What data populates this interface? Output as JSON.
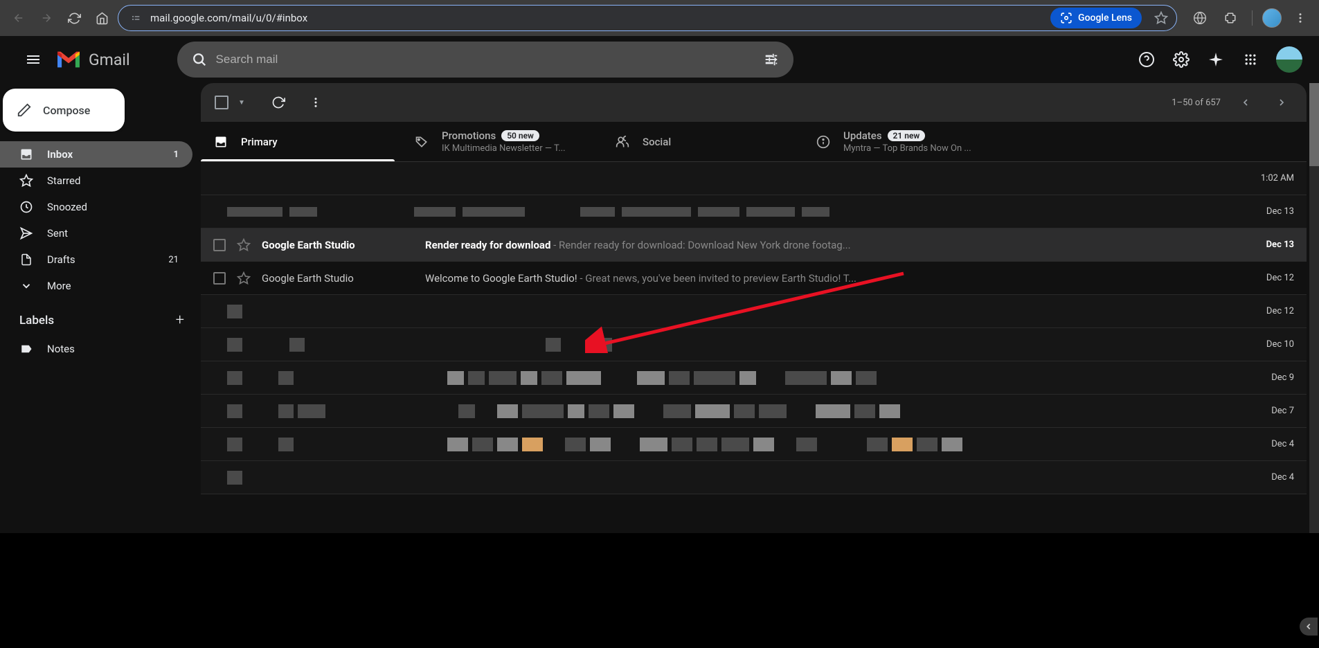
{
  "browser": {
    "url_display": "mail.google.com/mail/u/0/#inbox",
    "lens_label": "Google Lens"
  },
  "header": {
    "app_name": "Gmail",
    "search_placeholder": "Search mail"
  },
  "compose_label": "Compose",
  "nav": {
    "inbox": {
      "label": "Inbox",
      "count": "1"
    },
    "starred": {
      "label": "Starred"
    },
    "snoozed": {
      "label": "Snoozed"
    },
    "sent": {
      "label": "Sent"
    },
    "drafts": {
      "label": "Drafts",
      "count": "21"
    },
    "more": {
      "label": "More"
    }
  },
  "labels_header": "Labels",
  "user_labels": {
    "notes": "Notes"
  },
  "toolbar": {
    "page_info": "1–50 of 657"
  },
  "tabs": {
    "primary": {
      "name": "Primary"
    },
    "promotions": {
      "name": "Promotions",
      "badge": "50 new",
      "sub": "IK Multimedia Newsletter — T..."
    },
    "social": {
      "name": "Social"
    },
    "updates": {
      "name": "Updates",
      "badge": "21 new",
      "sub": "Myntra — Top Brands Now On ..."
    }
  },
  "emails": [
    {
      "sender": "",
      "subject": "",
      "date": "1:02 AM",
      "unread": false,
      "blur": true
    },
    {
      "sender": "",
      "subject": "",
      "date": "Dec 13",
      "unread": false,
      "blur": true
    },
    {
      "sender": "Google Earth Studio",
      "subject": "Render ready for download",
      "preview": " - Render ready for download: Download New York drone footag...",
      "date": "Dec 13",
      "unread": true,
      "highlight": true
    },
    {
      "sender": "Google Earth Studio",
      "subject": "Welcome to Google Earth Studio!",
      "preview": " - Great news, you've been invited to preview Earth Studio! T...",
      "date": "Dec 12",
      "unread": false
    },
    {
      "sender": "",
      "subject": "",
      "date": "Dec 12",
      "unread": false,
      "blur": true
    },
    {
      "sender": "",
      "subject": "",
      "date": "Dec 10",
      "unread": false,
      "blur": true
    },
    {
      "sender": "",
      "subject": "",
      "date": "Dec 9",
      "unread": false,
      "blur": true
    },
    {
      "sender": "",
      "subject": "",
      "date": "Dec 7",
      "unread": false,
      "blur": true
    },
    {
      "sender": "",
      "subject": "",
      "date": "Dec 4",
      "unread": false,
      "blur": true
    },
    {
      "sender": "",
      "subject": "",
      "date": "Dec 4",
      "unread": false,
      "blur": true
    }
  ]
}
